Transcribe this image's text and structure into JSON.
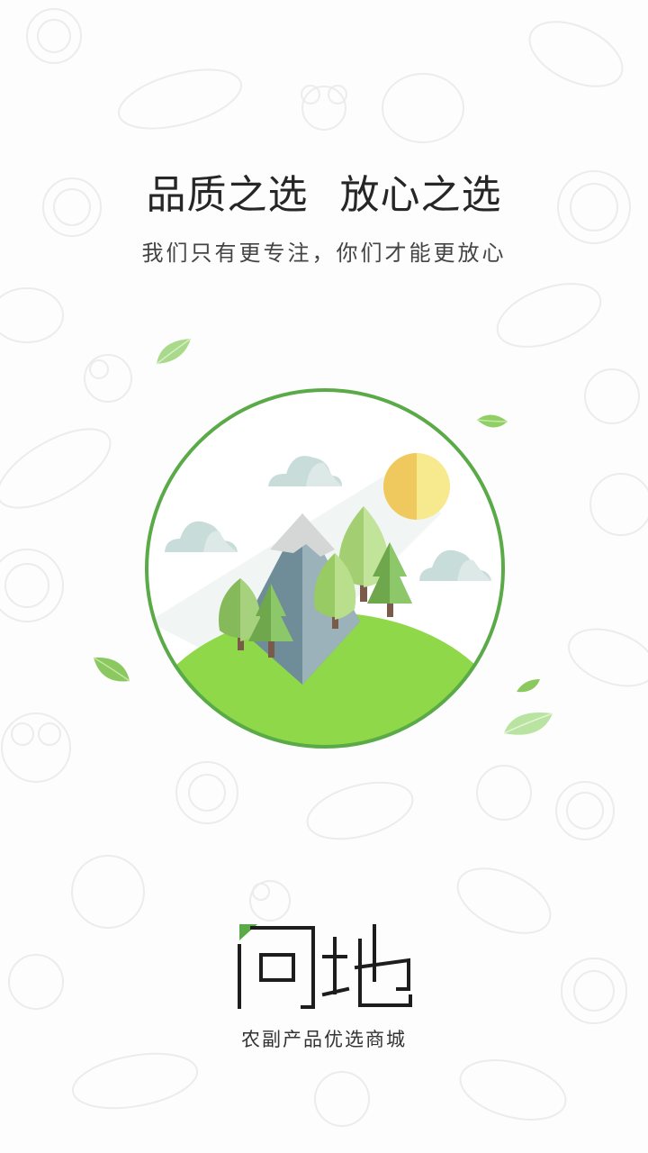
{
  "splash": {
    "headline": "品质之选  放心之选",
    "subline": "我们只有更专注，你们才能更放心",
    "logo_text": "问地",
    "tagline": "农副产品优选商城"
  },
  "colors": {
    "accent_green": "#5aaa48",
    "hill_green": "#8fd84a",
    "sun": "#f7e98e",
    "cloud": "#c8dcda",
    "text_dark": "#262626"
  },
  "icons": {
    "illustration": "mountain-landscape-illustration",
    "leaf": "leaf-icon",
    "logo": "wendi-logo"
  }
}
